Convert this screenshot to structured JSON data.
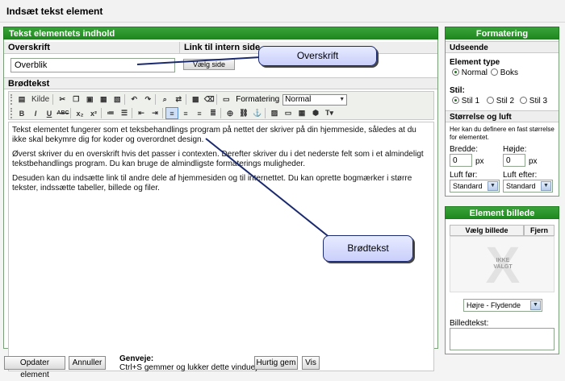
{
  "window": {
    "title": "Indsæt tekst element"
  },
  "left_panel": {
    "header": "Tekst elementets indhold",
    "overskrift_label": "Overskrift",
    "overskrift_value": "Overblik",
    "link_label": "Link til intern side",
    "vaelg_side_button": "Vælg side",
    "brodtekst_label": "Brødtekst"
  },
  "toolbar": {
    "kilde_label": "Kilde",
    "formatering_label": "Formatering",
    "formatering_value": "Normal",
    "bold": "B",
    "italic": "I",
    "underline": "U",
    "strike": "ABC",
    "subscript": "x₂",
    "superscript": "x²"
  },
  "editor": {
    "paragraphs": [
      "Tekst elementet fungerer som et teksbehandlings program på nettet der skriver på din hjemmeside, således at du ikke skal bekymre dig for koder og overordnet design.",
      "Øverst skriver du en overskrift hvis det passer i contexten. Derefter skriver du i det nederste felt som i et almindeligt tekstbehandlings program. Du kan bruge de almindligste formaterings muligheder.",
      "Desuden kan du indsætte link til andre dele af hjemmesiden og til internettet. Du kan oprette bogmærker i større tekster, indssætte tabeller, billede og filer."
    ]
  },
  "formatering_panel": {
    "header": "Formatering",
    "udseende_label": "Udseende",
    "element_type_label": "Element type",
    "element_type_options": [
      "Normal",
      "Boks"
    ],
    "element_type_selected": "Normal",
    "stil_label": "Stil:",
    "stil_options": [
      "Stil 1",
      "Stil 2",
      "Stil 3"
    ],
    "stil_selected": "Stil 1",
    "storrelse_label": "Størrelse og luft",
    "storrelse_help": "Her kan du definere en fast størrelse for elementet.",
    "bredde_label": "Bredde:",
    "bredde_value": "0",
    "bredde_unit": "px",
    "hojde_label": "Højde:",
    "hojde_value": "0",
    "hojde_unit": "px",
    "luft_for_label": "Luft før:",
    "luft_for_value": "Standard",
    "luft_efter_label": "Luft efter:",
    "luft_efter_value": "Standard"
  },
  "element_billede_panel": {
    "header": "Element billede",
    "vaelg_billede": "Vælg billede",
    "fjern": "Fjern",
    "ikke_valgt_line1": "IKKE",
    "ikke_valgt_line2": "VALGT",
    "placement_value": "Højre - Flydende",
    "billedtekst_label": "Billedtekst:"
  },
  "bottom_bar": {
    "opdater_button": "Opdater element",
    "annuller_button": "Annuller",
    "genveje_label": "Genveje:",
    "genveje_text": "Ctrl+S gemmer og lukker dette vindue)",
    "hurtig_gem_button": "Hurtig gem",
    "vis_button": "Vis"
  },
  "callouts": {
    "overskrift": "Overskrift",
    "brodtekst": "Brødtekst"
  },
  "colors": {
    "panel_header_green": "#2a9a2a",
    "callout_fill": "#d6dcff",
    "callout_border": "#1b2a6e"
  }
}
